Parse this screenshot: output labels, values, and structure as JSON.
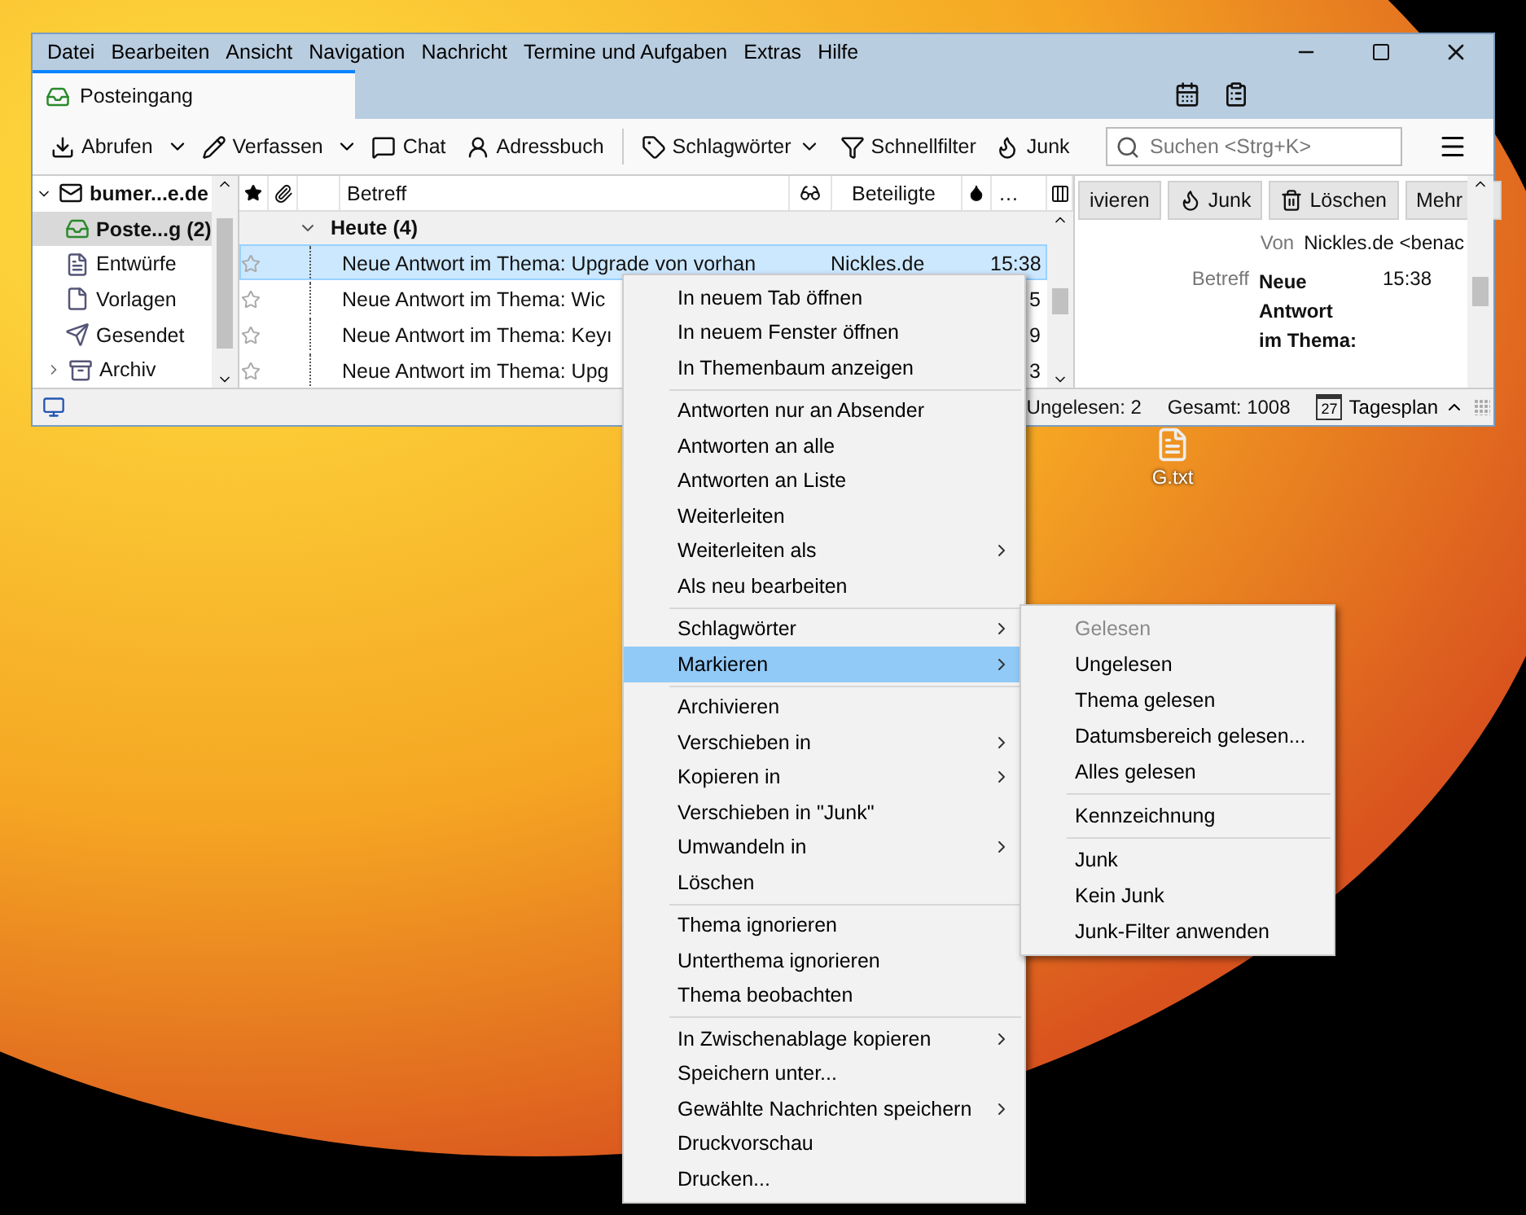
{
  "menubar": [
    {
      "label": "Datei"
    },
    {
      "label": "Bearbeiten"
    },
    {
      "label": "Ansicht"
    },
    {
      "label": "Navigation"
    },
    {
      "label": "Nachricht"
    },
    {
      "label": "Termine und Aufgaben"
    },
    {
      "label": "Extras"
    },
    {
      "label": "Hilfe"
    }
  ],
  "tabs": [
    {
      "label": "Posteingang",
      "selected": true
    }
  ],
  "toolbar": {
    "buttons": [
      {
        "label": "Abrufen",
        "kind": "split"
      },
      {
        "label": "Verfassen",
        "kind": "split"
      },
      {
        "label": "Chat",
        "kind": "plain"
      },
      {
        "label": "Adressbuch",
        "kind": "plain"
      },
      {
        "label": "Schlagwörter",
        "kind": "dropdown"
      },
      {
        "label": "Schnellfilter",
        "kind": "plain"
      },
      {
        "label": "Junk",
        "kind": "plain"
      }
    ],
    "search": {
      "placeholder": "Suchen <Strg+K>"
    }
  },
  "folder_pane": {
    "account": {
      "name": "bumer...e.de",
      "expanded": true
    },
    "folders": [
      {
        "name": "Poste...g (2)",
        "selected": true,
        "unread": true
      },
      {
        "name": "Entwürfe",
        "selected": false,
        "unread": false
      },
      {
        "name": "Vorlagen",
        "selected": false,
        "unread": false
      },
      {
        "name": "Gesendet",
        "selected": false,
        "unread": false
      },
      {
        "name": "Archiv",
        "selected": false,
        "unread": false,
        "expanded": false
      }
    ]
  },
  "message_list": {
    "columns": {
      "subject": "Betreff",
      "correspondents": "Beteiligte",
      "column_8": "…"
    },
    "group": {
      "label": "Heute (4)",
      "expanded": true
    },
    "rows": [
      {
        "subject": "Neue Antwort im Thema: Upgrade von vorhan",
        "sender": "Nickles.de",
        "time": "15:38",
        "selected": true,
        "starred": false
      },
      {
        "subject": "Neue Antwort im Thema: Wic",
        "time": "5",
        "selected": false,
        "starred": false
      },
      {
        "subject": "Neue Antwort im Thema: Keyı",
        "time": "9",
        "selected": false,
        "starred": false
      },
      {
        "subject": "Neue Antwort im Thema: Upg",
        "time": "3",
        "selected": false,
        "starred": false
      }
    ]
  },
  "reading_pane": {
    "buttons": [
      {
        "label": "ivieren",
        "kind": "plain"
      },
      {
        "label": "Junk",
        "kind": "junk"
      },
      {
        "label": "Löschen",
        "kind": "delete"
      },
      {
        "label": "Mehr",
        "kind": "dropdown"
      }
    ],
    "from": {
      "label": "Von",
      "value": "Nickles.de <benac"
    },
    "subject": {
      "label": "Betreff",
      "value": "Neue Antwort im Thema:",
      "time": "15:38"
    }
  },
  "status_bar": {
    "unread": "Ungelesen: 2",
    "total": "Gesamt: 1008",
    "today_pane": {
      "day": "27",
      "label": "Tagesplan"
    }
  },
  "desktop_icons": [
    {
      "label": "G.txt"
    }
  ],
  "context_menu": {
    "groups": [
      [
        {
          "label": "In neuem Tab öffnen",
          "submenu": false,
          "selected": false
        },
        {
          "label": "In neuem Fenster öffnen",
          "submenu": false,
          "selected": false
        },
        {
          "label": "In Themenbaum anzeigen",
          "submenu": false,
          "selected": false
        }
      ],
      [
        {
          "label": "Antworten nur an Absender",
          "submenu": false,
          "selected": false
        },
        {
          "label": "Antworten an alle",
          "submenu": false,
          "selected": false
        },
        {
          "label": "Antworten an Liste",
          "submenu": false,
          "selected": false
        },
        {
          "label": "Weiterleiten",
          "submenu": false,
          "selected": false
        },
        {
          "label": "Weiterleiten als",
          "submenu": true,
          "selected": false
        },
        {
          "label": "Als neu bearbeiten",
          "submenu": false,
          "selected": false
        }
      ],
      [
        {
          "label": "Schlagwörter",
          "submenu": true,
          "selected": false
        },
        {
          "label": "Markieren",
          "submenu": true,
          "selected": true
        }
      ],
      [
        {
          "label": "Archivieren",
          "submenu": false,
          "selected": false
        },
        {
          "label": "Verschieben in",
          "submenu": true,
          "selected": false
        },
        {
          "label": "Kopieren in",
          "submenu": true,
          "selected": false
        },
        {
          "label": "Verschieben in \"Junk\"",
          "submenu": false,
          "selected": false
        },
        {
          "label": "Umwandeln in",
          "submenu": true,
          "selected": false
        },
        {
          "label": "Löschen",
          "submenu": false,
          "selected": false
        }
      ],
      [
        {
          "label": "Thema ignorieren",
          "submenu": false,
          "selected": false
        },
        {
          "label": "Unterthema ignorieren",
          "submenu": false,
          "selected": false
        },
        {
          "label": "Thema beobachten",
          "submenu": false,
          "selected": false
        }
      ],
      [
        {
          "label": "In Zwischenablage kopieren",
          "submenu": true,
          "selected": false
        },
        {
          "label": "Speichern unter...",
          "submenu": false,
          "selected": false
        },
        {
          "label": "Gewählte Nachrichten speichern",
          "submenu": true,
          "selected": false
        },
        {
          "label": "Druckvorschau",
          "submenu": false,
          "selected": false
        },
        {
          "label": "Drucken...",
          "submenu": false,
          "selected": false
        }
      ]
    ]
  },
  "submenu": {
    "groups": [
      [
        {
          "label": "Gelesen",
          "disabled": true
        },
        {
          "label": "Ungelesen",
          "disabled": false
        },
        {
          "label": "Thema gelesen",
          "disabled": false
        },
        {
          "label": "Datumsbereich gelesen...",
          "disabled": false
        },
        {
          "label": "Alles gelesen",
          "disabled": false
        }
      ],
      [
        {
          "label": "Kennzeichnung",
          "disabled": false
        }
      ],
      [
        {
          "label": "Junk",
          "disabled": false
        },
        {
          "label": "Kein Junk",
          "disabled": false
        },
        {
          "label": "Junk-Filter anwenden",
          "disabled": false
        }
      ]
    ]
  }
}
